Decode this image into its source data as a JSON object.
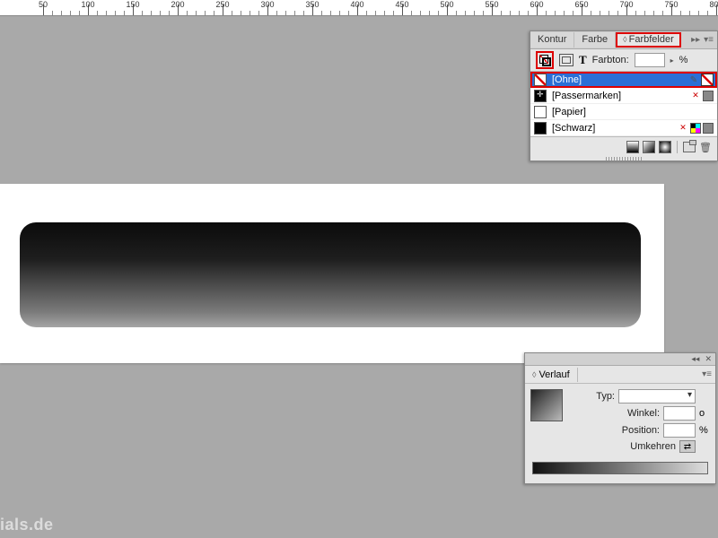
{
  "ruler": {
    "start": 50,
    "end": 800,
    "step": 50
  },
  "swatches_panel": {
    "tabs": {
      "kontur": "Kontur",
      "farbe": "Farbe",
      "farbfelder": "Farbfelder"
    },
    "tint_label": "Farbton:",
    "tint_value": "",
    "tint_unit": "%",
    "items": [
      {
        "name": "[Ohne]",
        "chip": "none",
        "selected": true,
        "flags": [
          "pencil",
          "none-big"
        ]
      },
      {
        "name": "[Passermarken]",
        "chip": "reg",
        "selected": false,
        "flags": [
          "x",
          "spot"
        ]
      },
      {
        "name": "[Papier]",
        "chip": "white",
        "selected": false,
        "flags": []
      },
      {
        "name": "[Schwarz]",
        "chip": "black",
        "selected": false,
        "flags": [
          "x",
          "cmyk",
          "spot"
        ]
      }
    ]
  },
  "verlauf_panel": {
    "title": "Verlauf",
    "fields": {
      "typ_label": "Typ:",
      "typ_value": "",
      "winkel_label": "Winkel:",
      "winkel_value": "",
      "winkel_unit": "o",
      "position_label": "Position:",
      "position_value": "",
      "position_unit": "%",
      "umkehren_label": "Umkehren"
    }
  },
  "watermark": "ials.de"
}
